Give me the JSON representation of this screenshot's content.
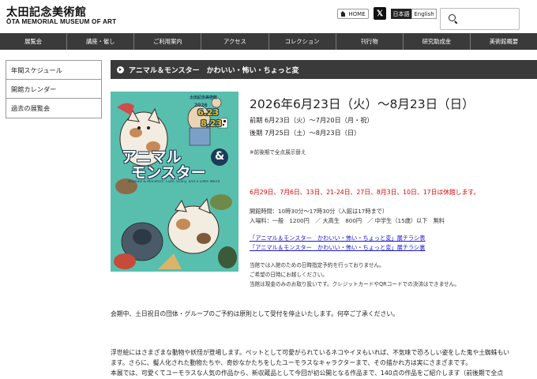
{
  "header": {
    "logo_ja": "太田記念美術館",
    "logo_en": "ŌTA MEMORIAL MUSEUM OF ART",
    "home_label": "HOME",
    "lang_ja": "日本語",
    "lang_en": "English"
  },
  "nav": [
    "展覧会",
    "講座・催し",
    "ご利用案内",
    "アクセス",
    "コレクション",
    "刊行物",
    "研究助成金",
    "美術館概要"
  ],
  "sidebar": [
    "年間スケジュール",
    "開館カレンダー",
    "過去の展覧会"
  ],
  "exhibition": {
    "title": "アニマル＆モンスター　かわいい・怖い・ちょっと変",
    "poster": {
      "museum": "太田記念美術館",
      "year": "2026",
      "date_start": "6.23",
      "date_end": "8.23",
      "title_line1": "アニマル",
      "title_amp": "&",
      "title_line2": "モンスター",
      "subtitle_en": "Animals & Monsters: Cute, Scary, and a Little Weird"
    },
    "dates": "2026年6月23日（火）〜8月23日（日）",
    "period1": "前期 6月23日（火）〜7月20日（月・祝）",
    "period2": "後期 7月25日（土）〜8月23日（日）",
    "note_change": "※前後期で全点展示替え",
    "closed": "6月29日、7月6日、13日、21-24日、27日、8月3日、10日、17日は休館します。",
    "hours": "開館時間：10時30分〜17時30分（入館は17時まで）",
    "fee": "入場料：一般　1200円　／ 大高生　800円　／ 中学生（15歳）以下　無料",
    "link1": "「アニマル＆モンスター　かわいい・怖い・ちょっと変」展チラシ表",
    "link2": "「アニマル＆モンスター　かわいい・怖い・ちょっと変」展チラシ裏",
    "notice1": "当館では入館のための日時指定予約を行っておりません。",
    "notice2": "ご希望の日時にお越しください。",
    "notice3": "当館は現金のみのお取り扱いです。クレジットカードやQRコードでの決済はできません。",
    "group_notice": "会期中、土日祝日の団体・グループのご予約は原則として受付を停止いたします。何卒ご了承ください。",
    "desc1": "浮世絵にはさまざまな動物や妖怪が登場します。ペットとして可愛がられているネコやイヌもいれば、不気味で恐ろしい姿をした鬼や土蜘蛛もい",
    "desc2": "ます。さらに、擬人化された動物たちや、奇妙なかたちをしたユーモラスなキャラクターまで、その描かれ方は実にさまざまです。",
    "desc3": "本展では、可愛くてユーモラスな人気の作品から、新収蔵品として今回が初公開となる作品まで、140点の作品をご紹介します（前後期で全点"
  },
  "colors": {
    "nav_bg": "#3a3a3a",
    "red_text": "#e00000",
    "link": "#1a1ad4",
    "poster_bg": "#58bfae"
  }
}
